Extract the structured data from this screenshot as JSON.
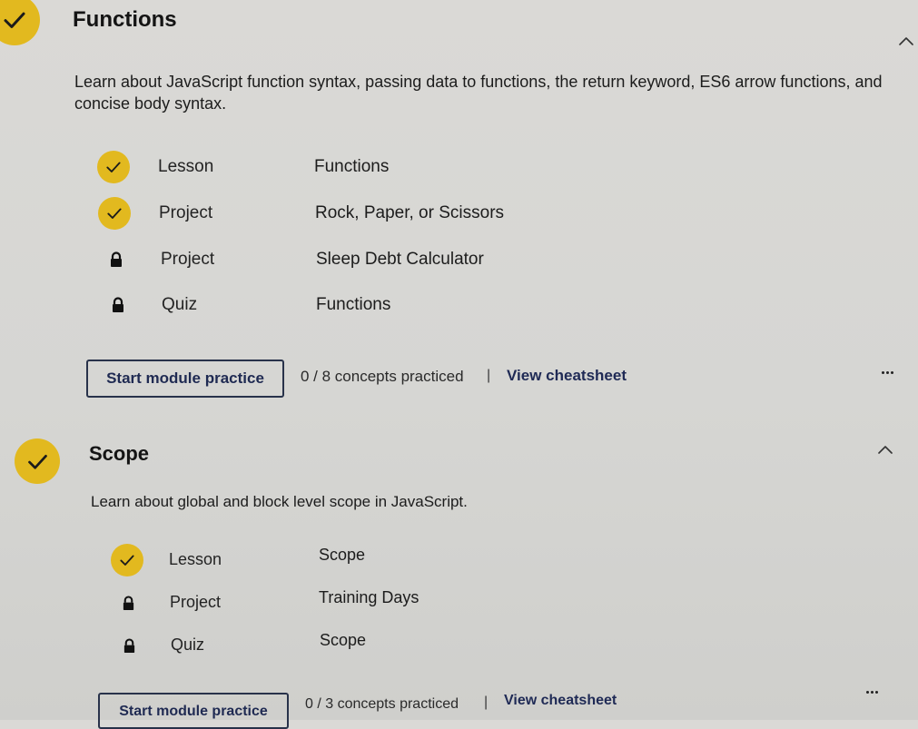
{
  "colors": {
    "accent_yellow": "#e2b91f",
    "navy": "#1f2a52",
    "background": "#d9d8d5"
  },
  "modules": [
    {
      "title": "Functions",
      "completed": true,
      "description": "Learn about JavaScript function syntax, passing data to functions, the return keyword, ES6 arrow functions, and concise body syntax.",
      "items": [
        {
          "type": "Lesson",
          "name": "Functions",
          "status": "completed",
          "icon": "check-icon"
        },
        {
          "type": "Project",
          "name": "Rock, Paper, or Scissors",
          "status": "completed",
          "icon": "check-icon"
        },
        {
          "type": "Project",
          "name": "Sleep Debt Calculator",
          "status": "locked",
          "icon": "lock-icon"
        },
        {
          "type": "Quiz",
          "name": "Functions",
          "status": "locked",
          "icon": "lock-icon"
        }
      ],
      "practice_button_label": "Start module practice",
      "concepts_text": "0 / 8 concepts practiced",
      "divider": "|",
      "cheatsheet_label": "View cheatsheet"
    },
    {
      "title": "Scope",
      "completed": true,
      "description": "Learn about global and block level scope in JavaScript.",
      "items": [
        {
          "type": "Lesson",
          "name": "Scope",
          "status": "completed",
          "icon": "check-icon"
        },
        {
          "type": "Project",
          "name": "Training Days",
          "status": "locked",
          "icon": "lock-icon"
        },
        {
          "type": "Quiz",
          "name": "Scope",
          "status": "locked",
          "icon": "lock-icon"
        }
      ],
      "practice_button_label": "Start module practice",
      "concepts_text": "0 / 3 concepts practiced",
      "divider": "|",
      "cheatsheet_label": "View cheatsheet"
    }
  ]
}
